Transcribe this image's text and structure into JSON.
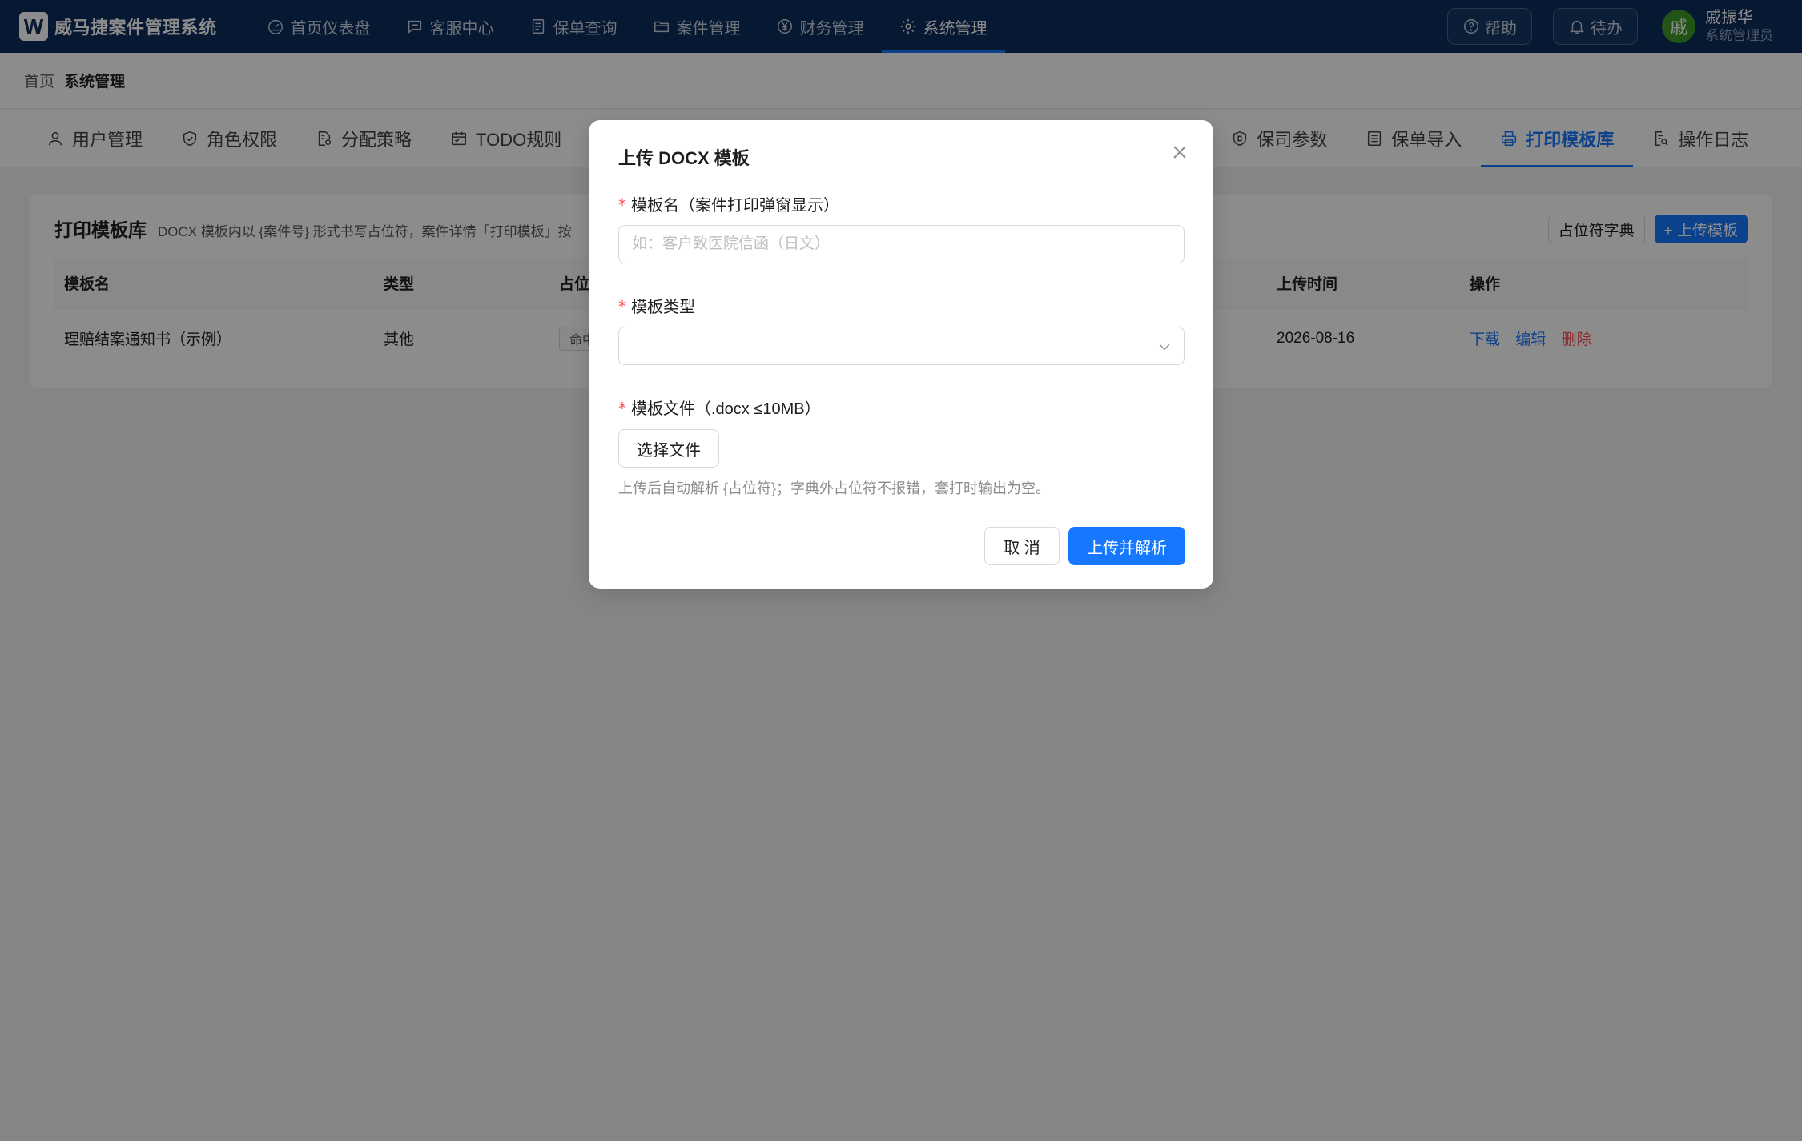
{
  "app": {
    "logo_letter": "W",
    "title": "威马捷案件管理系统"
  },
  "topnav": [
    {
      "label": "首页仪表盘",
      "icon": "dashboard-icon"
    },
    {
      "label": "客服中心",
      "icon": "chat-icon"
    },
    {
      "label": "保单查询",
      "icon": "document-icon"
    },
    {
      "label": "案件管理",
      "icon": "folder-icon"
    },
    {
      "label": "财务管理",
      "icon": "yen-icon"
    },
    {
      "label": "系统管理",
      "icon": "gear-icon",
      "active": true
    }
  ],
  "header_actions": {
    "help": "帮助",
    "todo": "待办"
  },
  "user": {
    "avatar_char": "戚",
    "name": "戚振华",
    "role": "系统管理员",
    "avatar_color": "#3f9b27"
  },
  "breadcrumb": {
    "home": "首页",
    "current": "系统管理"
  },
  "subtabs": [
    {
      "label": "用户管理",
      "icon": "user-icon"
    },
    {
      "label": "角色权限",
      "icon": "shield-check-icon"
    },
    {
      "label": "分配策略",
      "icon": "file-gear-icon"
    },
    {
      "label": "TODO规则",
      "icon": "calendar-icon"
    },
    {
      "label": "保司参数",
      "icon": "shield-icon"
    },
    {
      "label": "保单导入",
      "icon": "list-icon"
    },
    {
      "label": "打印模板库",
      "icon": "printer-icon",
      "active": true
    },
    {
      "label": "操作日志",
      "icon": "log-search-icon"
    }
  ],
  "card": {
    "title": "打印模板库",
    "desc": "DOCX 模板内以 {案件号} 形式书写占位符，案件详情「打印模板」按",
    "dict_button": "占位符字典",
    "upload_button": "+ 上传模板"
  },
  "table": {
    "headers": {
      "name": "模板名",
      "type": "类型",
      "placeholder": "占位",
      "uploaded": "上传时间",
      "actions": "操作"
    },
    "rows": [
      {
        "name": "理赔结案通知书（示例）",
        "type": "其他",
        "placeholder_tag": "命中",
        "uploaded": "2026-08-16",
        "download": "下载",
        "edit": "编辑",
        "delete": "删除"
      }
    ]
  },
  "modal": {
    "title": "上传 DOCX 模板",
    "name_label": "模板名（案件打印弹窗显示）",
    "name_placeholder": "如：客户致医院信函（日文）",
    "name_value": "",
    "type_label": "模板类型",
    "type_value": "",
    "file_label": "模板文件（.docx ≤10MB）",
    "file_button": "选择文件",
    "hint": "上传后自动解析 {占位符}；字典外占位符不报错，套打时输出为空。",
    "cancel": "取 消",
    "submit": "上传并解析",
    "required_mark": "*"
  },
  "colors": {
    "primary": "#1677ff",
    "topbar": "#0d2d5e",
    "danger": "#ff4d4f"
  }
}
